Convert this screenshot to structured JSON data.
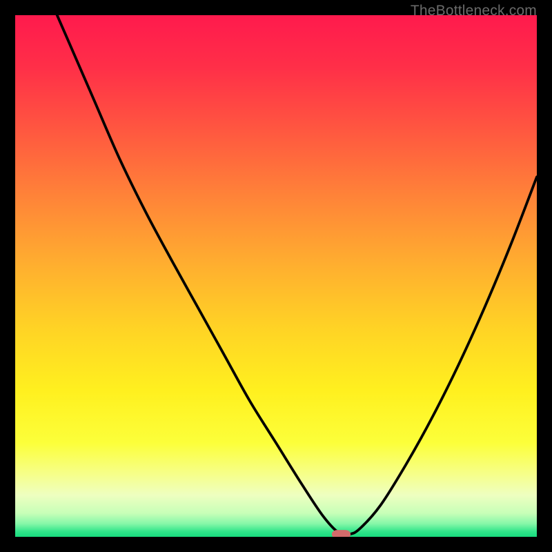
{
  "watermark": "TheBottleneck.com",
  "colors": {
    "black": "#000000",
    "curve": "#000000",
    "marker": "#d26b6b"
  },
  "gradient_stops": [
    {
      "pos": 0.0,
      "color": "#ff1a4d"
    },
    {
      "pos": 0.1,
      "color": "#ff2f48"
    },
    {
      "pos": 0.22,
      "color": "#ff5740"
    },
    {
      "pos": 0.35,
      "color": "#ff8438"
    },
    {
      "pos": 0.48,
      "color": "#ffaf2f"
    },
    {
      "pos": 0.6,
      "color": "#ffd325"
    },
    {
      "pos": 0.72,
      "color": "#fff01f"
    },
    {
      "pos": 0.82,
      "color": "#fcff3a"
    },
    {
      "pos": 0.88,
      "color": "#f6ff8a"
    },
    {
      "pos": 0.92,
      "color": "#eeffc0"
    },
    {
      "pos": 0.955,
      "color": "#c7ffb8"
    },
    {
      "pos": 0.975,
      "color": "#85f7a8"
    },
    {
      "pos": 0.99,
      "color": "#30e58a"
    },
    {
      "pos": 1.0,
      "color": "#18da7e"
    }
  ],
  "chart_data": {
    "type": "line",
    "title": "",
    "xlabel": "",
    "ylabel": "",
    "xlim": [
      0,
      100
    ],
    "ylim": [
      0,
      100
    ],
    "grid": false,
    "legend": false,
    "marker": {
      "x": 62.5,
      "y": 0,
      "color": "#d26b6b"
    },
    "series": [
      {
        "name": "bottleneck-curve",
        "color": "#000000",
        "x": [
          0,
          5,
          10,
          15,
          20,
          25,
          30,
          35,
          40,
          45,
          50,
          55,
          59,
          62,
          64,
          66,
          70,
          75,
          80,
          85,
          90,
          95,
          100
        ],
        "values": [
          119,
          107,
          95.5,
          84,
          72.5,
          62.3,
          53,
          44,
          35,
          26,
          18,
          10,
          4,
          0.8,
          0.5,
          1.5,
          6,
          14,
          23,
          33,
          44,
          56,
          69
        ]
      }
    ]
  }
}
